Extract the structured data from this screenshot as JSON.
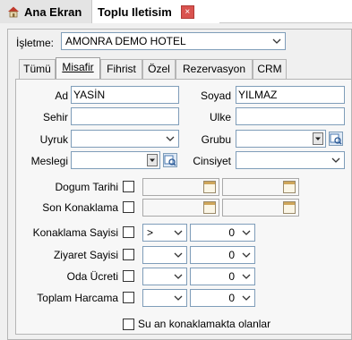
{
  "doc_tabs": {
    "home_label": "Ana Ekran",
    "active_label": "Toplu Iletisim",
    "close_glyph": "×"
  },
  "isletme": {
    "label": "İşletme:",
    "value": "AMONRA DEMO HOTEL"
  },
  "tabs": [
    "Tümü",
    "Misafir",
    "Fihrist",
    "Özel",
    "Rezervasyon",
    "CRM"
  ],
  "active_tab": "Misafir",
  "form": {
    "ad": {
      "label": "Ad",
      "value": "YASİN"
    },
    "soyad": {
      "label": "Soyad",
      "value": "YILMAZ"
    },
    "sehir": {
      "label": "Sehir",
      "value": ""
    },
    "ulke": {
      "label": "Ulke",
      "value": ""
    },
    "uyruk": {
      "label": "Uyruk",
      "value": ""
    },
    "grubu": {
      "label": "Grubu",
      "value": ""
    },
    "meslegi": {
      "label": "Meslegi",
      "value": ""
    },
    "cinsiyet": {
      "label": "Cinsiyet",
      "value": ""
    },
    "dogum_tarihi": {
      "label": "Dogum Tarihi",
      "checked": false
    },
    "son_konaklama": {
      "label": "Son Konaklama",
      "checked": false
    },
    "konaklama_sayisi": {
      "label": "Konaklama Sayisi",
      "checked": false,
      "operator": ">",
      "value": "0"
    },
    "ziyaret_sayisi": {
      "label": "Ziyaret Sayisi",
      "checked": false,
      "operator": "",
      "value": "0"
    },
    "oda_ucreti": {
      "label": "Oda Ücreti",
      "checked": false,
      "operator": "",
      "value": "0"
    },
    "toplam_harcama": {
      "label": "Toplam Harcama",
      "checked": false,
      "operator": "",
      "value": "0"
    },
    "su_an_konaklamakta": {
      "label": "Su an konaklamakta olanlar",
      "checked": false
    }
  },
  "icons": {
    "home": "home-icon",
    "close": "close-icon",
    "dropdown": "chevron-down-icon",
    "picker": "lookup-icon",
    "calendar": "calendar-icon"
  },
  "colors": {
    "close_button": "#d9534f",
    "field_border": "#7f9db9",
    "panel_bg": "#f0f0f0",
    "tab_body_bg": "#f7f7f7"
  }
}
